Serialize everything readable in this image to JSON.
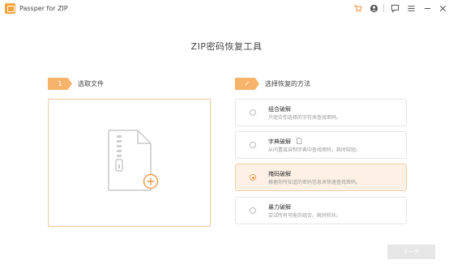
{
  "titlebar": {
    "app_name": "Passper for ZIP",
    "icons": [
      "app-icon",
      "cart-icon",
      "account-icon",
      "feedback-icon",
      "menu-icon",
      "minimize-icon",
      "close-icon"
    ],
    "cart_color": "#f39a4a"
  },
  "page": {
    "title": "ZIP密码恢复工具"
  },
  "step1": {
    "number": "1",
    "label": "选取文件"
  },
  "step2": {
    "check": "✓",
    "label": "选择恢复的方法"
  },
  "upload": {
    "icons": [
      "zip-file-icon",
      "add-icon"
    ]
  },
  "methods": [
    {
      "title": "组合破解",
      "desc": "只组合你选择的字符来查找密码。",
      "selected": false
    },
    {
      "title": "字典破解",
      "desc": "从内置或自制字典中查找密码，耗时较短。",
      "selected": false
    },
    {
      "title": "掩码破解",
      "desc": "根据你所知道的密码信息来快速查找密码。",
      "selected": true
    },
    {
      "title": "暴力破解",
      "desc": "尝试所有可能的组合，耗时较长。",
      "selected": false
    }
  ],
  "footer": {
    "next_label": "下一步"
  },
  "colors": {
    "accent": "#f39a4a",
    "accent_light": "#f8b36a",
    "selected_bg": "#fdf1e6"
  }
}
